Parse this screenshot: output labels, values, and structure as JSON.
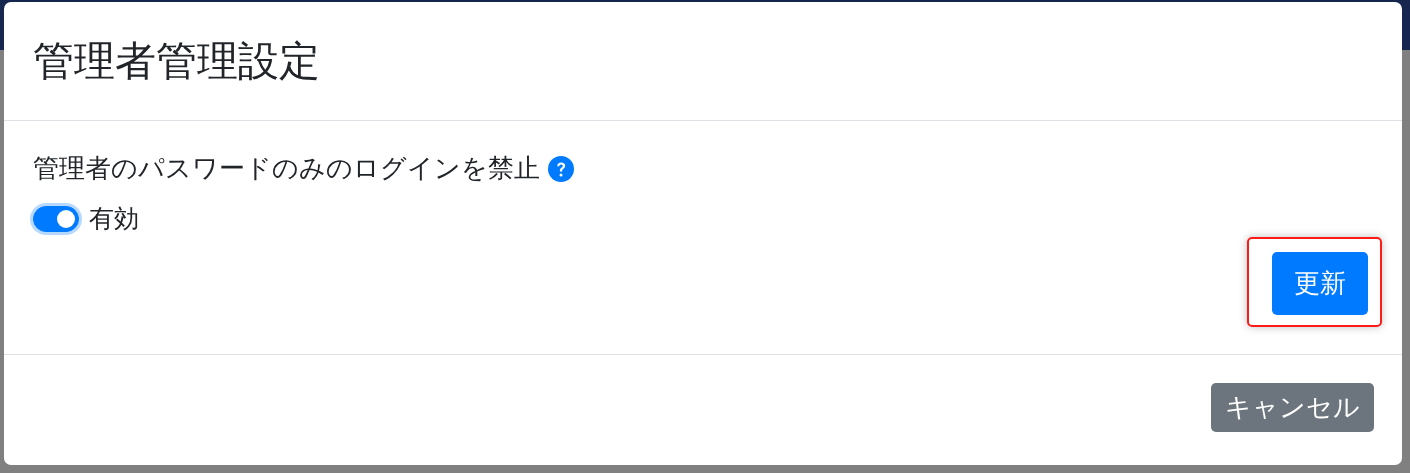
{
  "dialog": {
    "title": "管理者管理設定"
  },
  "setting": {
    "label": "管理者のパスワードのみのログインを禁止",
    "help": true,
    "toggle": {
      "on": true,
      "label": "有効"
    }
  },
  "update_button": {
    "label": "更新",
    "highlighted": true
  },
  "footer": {
    "buttons": [
      {
        "label": "キャンセル",
        "kind": "secondary"
      }
    ]
  }
}
